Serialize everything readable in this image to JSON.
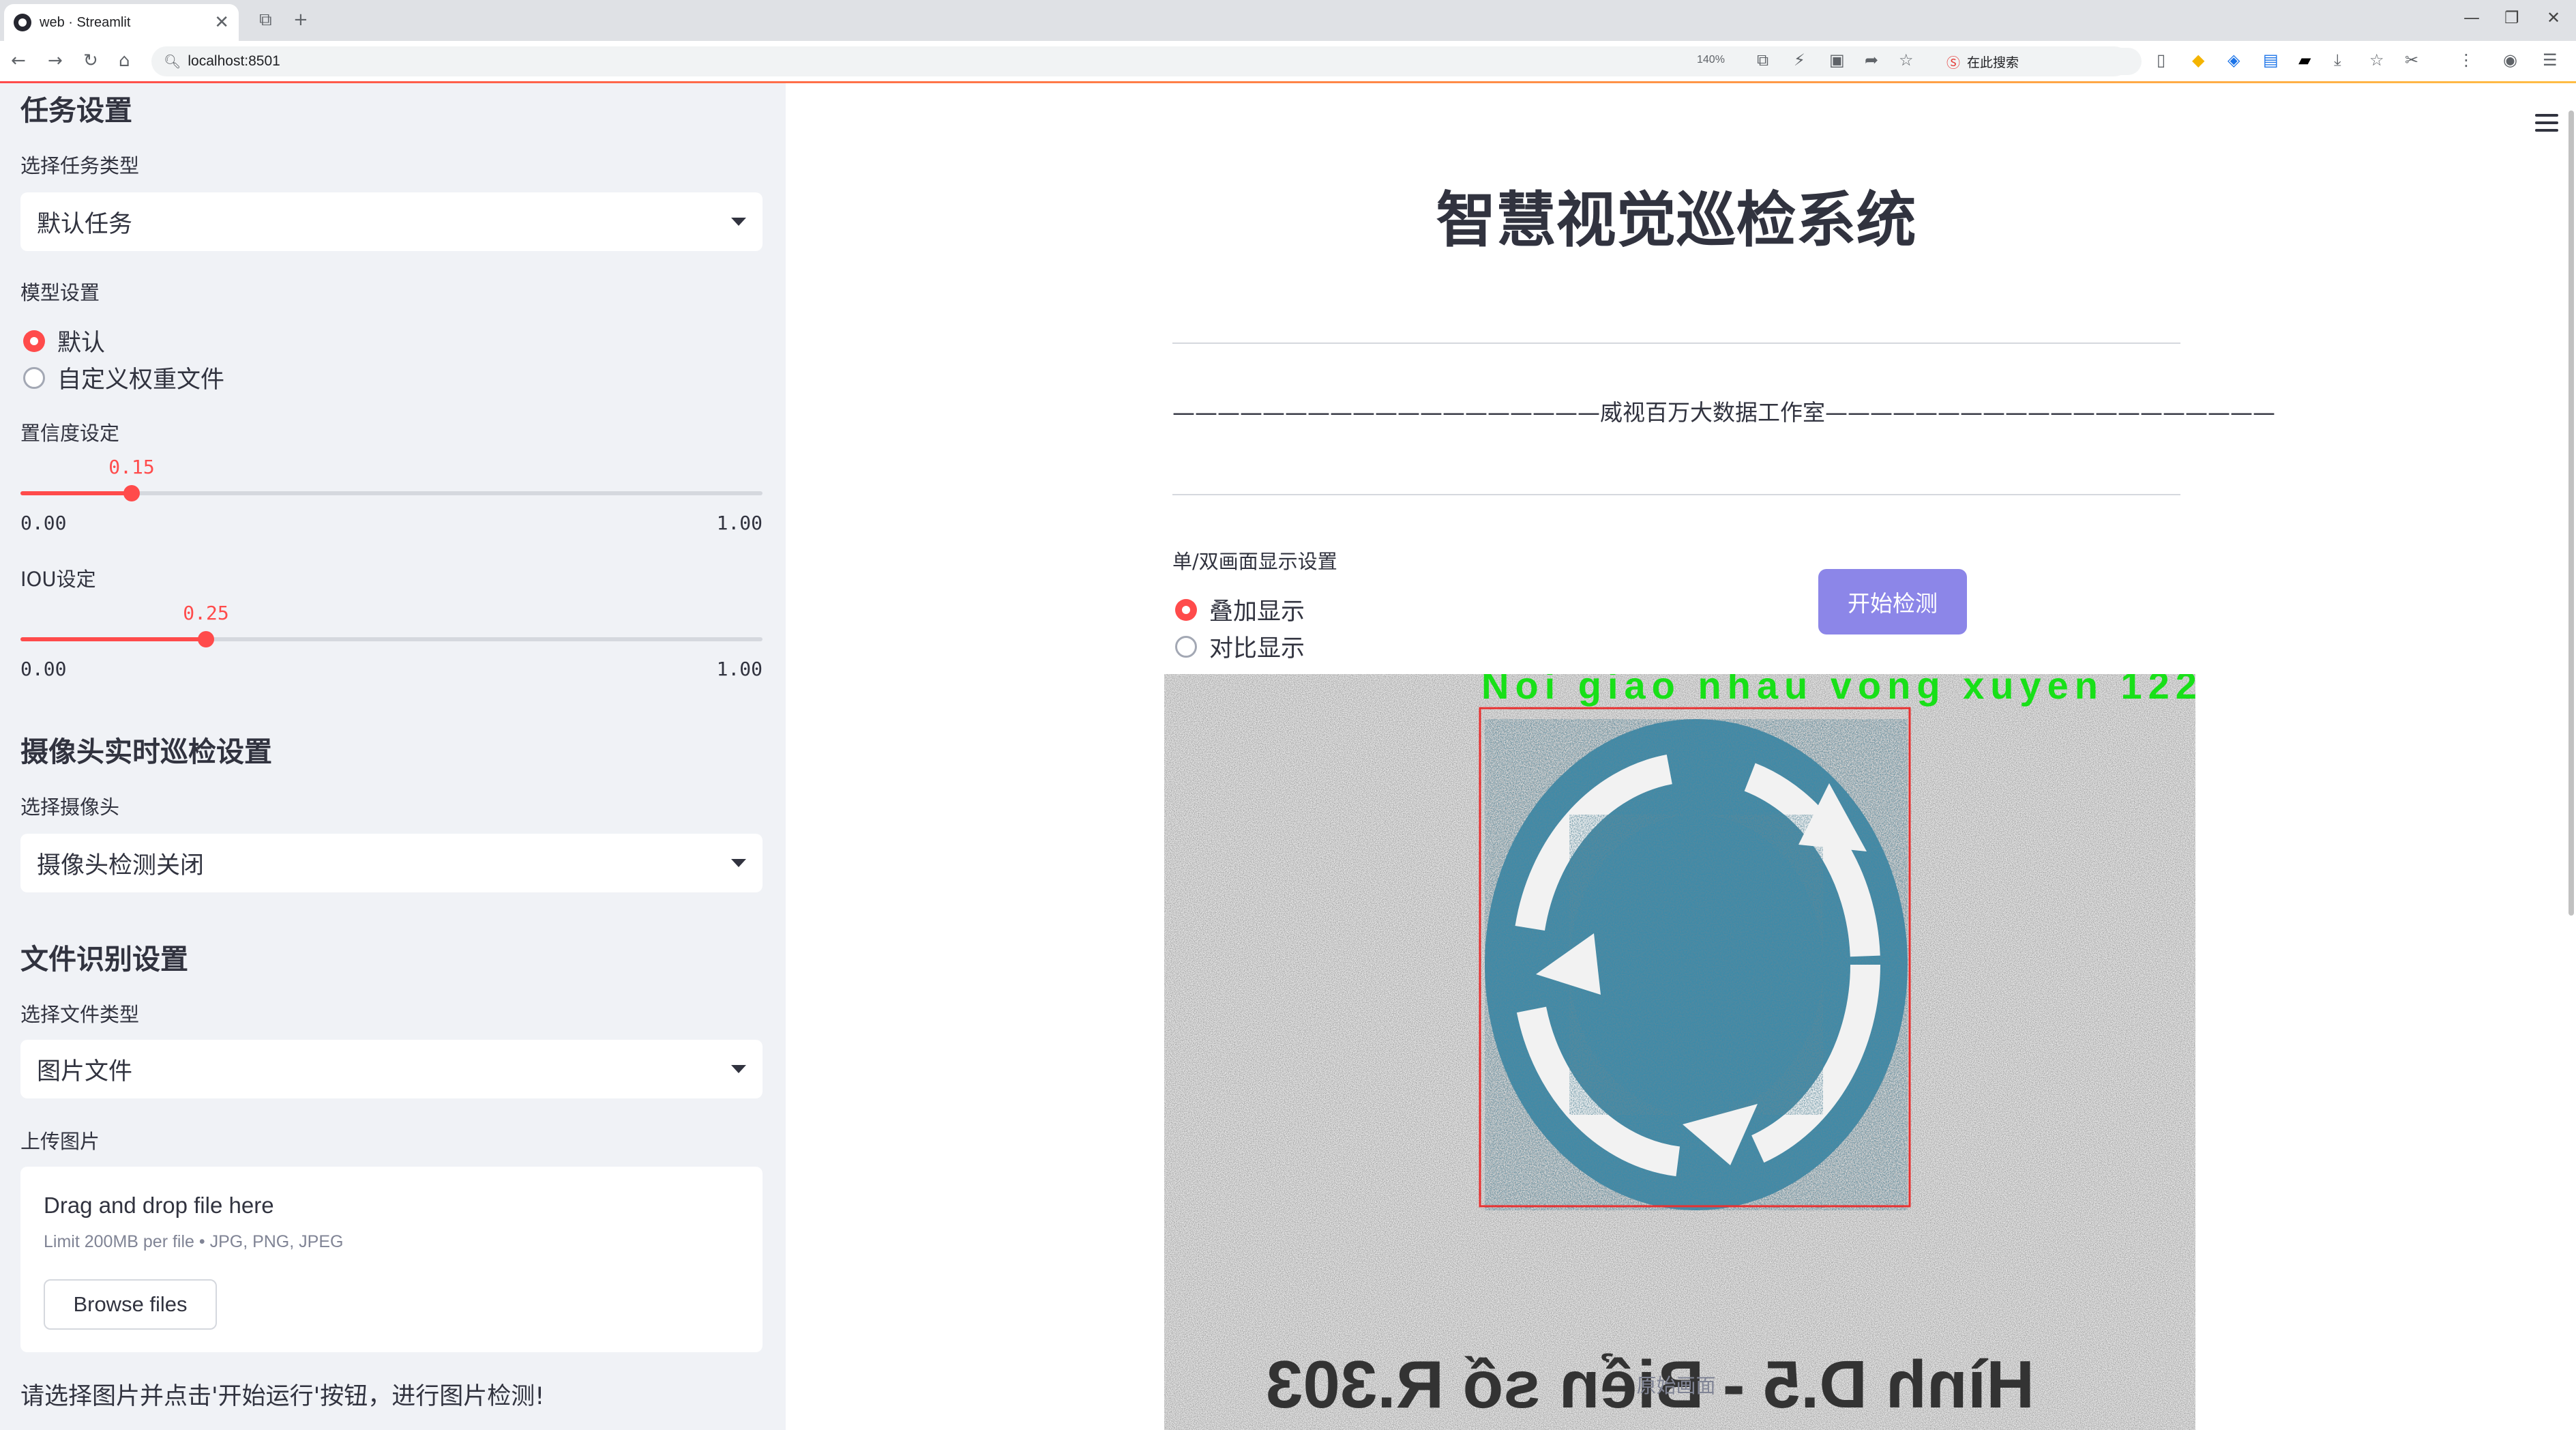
{
  "browser": {
    "tab_title": "web · Streamlit",
    "url": "localhost:8501",
    "zoom": "140%",
    "search_engine": "在此搜索"
  },
  "sidebar": {
    "task_section_title": "任务设置",
    "task_type_label": "选择任务类型",
    "task_type_value": "默认任务",
    "model_label": "模型设置",
    "model_options": [
      "默认",
      "自定义权重文件"
    ],
    "model_selected": "默认",
    "confidence_label": "置信度设定",
    "confidence": {
      "value": "0.15",
      "min": "0.00",
      "max": "1.00",
      "fraction": 0.15
    },
    "iou_label": "IOU设定",
    "iou": {
      "value": "0.25",
      "min": "0.00",
      "max": "1.00",
      "fraction": 0.25
    },
    "camera_section_title": "摄像头实时巡检设置",
    "camera_label": "选择摄像头",
    "camera_value": "摄像头检测关闭",
    "file_section_title": "文件识别设置",
    "file_type_label": "选择文件类型",
    "file_type_value": "图片文件",
    "upload_label": "上传图片",
    "upload_title": "Drag and drop file here",
    "upload_limit": "Limit 200MB per file • JPG, PNG, JPEG",
    "browse_button": "Browse files",
    "hint": "请选择图片并点击'开始运行'按钮，进行图片检测!"
  },
  "main": {
    "title": "智慧视觉巡检系统",
    "subtitle": "———————————————————威视百万大数据工作室————————————————————",
    "display_label": "单/双画面显示设置",
    "display_options": [
      "叠加显示",
      "对比显示"
    ],
    "display_selected": "叠加显示",
    "start_button": "开始检测",
    "detection_label": "Noi giao nhau vong xuyen 122",
    "sign_caption": "Hình D.5 - Biển số R.303",
    "image_caption": "原始画面",
    "colors": {
      "accent": "#ff4b4b",
      "button": "#8c86e8",
      "detection_box": "#e83030",
      "detection_text": "#18e018",
      "sign_blue": "#3d8aa8"
    }
  }
}
